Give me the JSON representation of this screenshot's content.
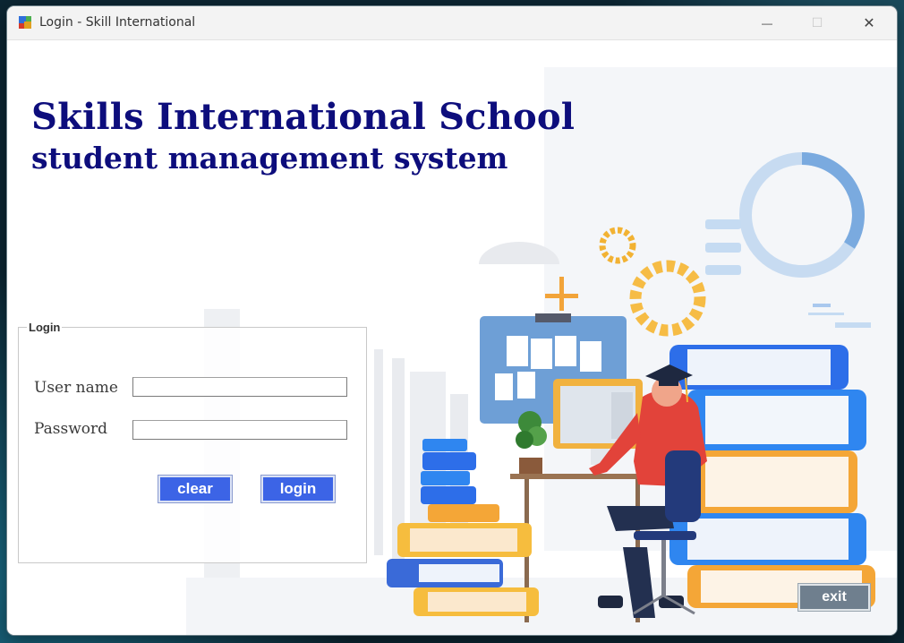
{
  "window": {
    "title": "Login - Skill International",
    "app_icon": "winforms-app-icon",
    "controls": {
      "minimize": "—",
      "maximize": "☐",
      "close": "✕"
    }
  },
  "header": {
    "title": "Skills International School",
    "subtitle": "student management system"
  },
  "login_group": {
    "legend": "Login",
    "username": {
      "label": "User name",
      "value": "",
      "placeholder": ""
    },
    "password": {
      "label": "Password",
      "value": "",
      "placeholder": ""
    },
    "clear_button": "clear",
    "login_button": "login"
  },
  "exit_button": "exit",
  "colors": {
    "heading": "#0d0d7c",
    "primary_button": "#3c64e6",
    "exit_button": "#6f7f8e"
  }
}
